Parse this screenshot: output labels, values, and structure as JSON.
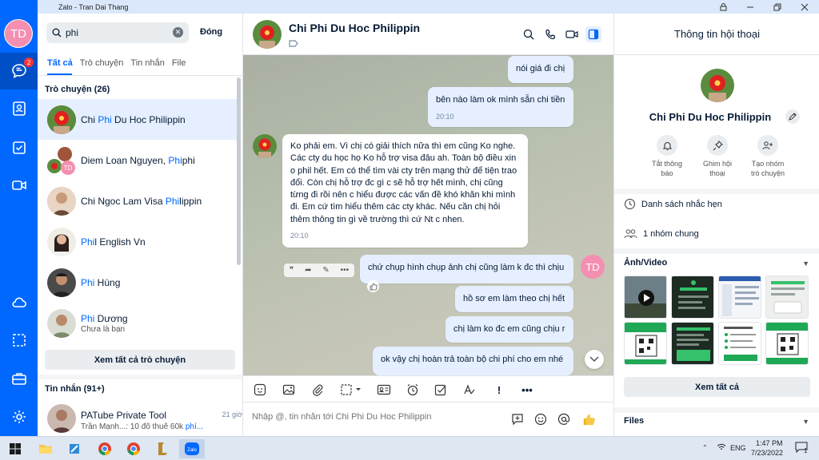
{
  "window": {
    "title": "Zalo - Tran Dai Thang"
  },
  "user": {
    "initials": "TD"
  },
  "nav": {
    "messages_badge": "2"
  },
  "search": {
    "value": "phi",
    "close_label": "Đóng"
  },
  "tabs": [
    "Tất cả",
    "Trò chuyện",
    "Tin nhắn",
    "File"
  ],
  "conversations_section": "Trò chuyện (26)",
  "conversations": [
    {
      "pre": "Chi ",
      "hl": "Phi",
      "post": " Du Hoc Philippin",
      "sub": ""
    },
    {
      "pre": "Diem Loan Nguyen, ",
      "hl": "Phi",
      "post": "phi",
      "sub": ""
    },
    {
      "pre": "Chi Ngoc Lam Visa ",
      "hl": "Phi",
      "post": "lippin",
      "sub": ""
    },
    {
      "pre": "",
      "hl": "Phi",
      "post": "l English Vn",
      "sub": ""
    },
    {
      "pre": "",
      "hl": "Phi",
      "post": " Hùng",
      "sub": ""
    },
    {
      "pre": "",
      "hl": "Phi",
      "post": " Dương",
      "sub": "Chưa là bạn"
    }
  ],
  "see_all_conversations": "Xem tất cả trò chuyện",
  "messages_section": "Tin nhắn (91+)",
  "message_results": [
    {
      "name": "PATube Private Tool",
      "time": "21 giờ",
      "sub_pre": "Trần Mạnh...: 10 đô thuê 60k ",
      "sub_hl": "phí..."
    }
  ],
  "chat": {
    "title": "Chi Phi Du Hoc Philippin",
    "messages": [
      {
        "from": "me",
        "text": "nói giá đi chị",
        "time": ""
      },
      {
        "from": "me",
        "text": "bên nào làm ok mình sẵn chi tiền",
        "time": "20:10"
      },
      {
        "from": "them",
        "text": "Ko phải em. Vì chị có giải thích nữa thì em cũng Ko nghe. Các cty du học họ Ko hỗ trợ visa đâu ah. Toàn bộ điều xin o phil hết. Em có thể tìm vài cty trên mạng thử để tiện trao đổi. Còn chị hỗ trợ đc gì c sẽ hỗ trợ hết mình, chị cũng từng đi rồi nên c hiểu được các vấn đề khó khăn khi mình đi. Em cứ tìm hiểu thêm các cty khác. Nếu cần chị hỏi thêm thông tin gì về trường thì cứ Nt c nhen.",
        "time": "20:10"
      },
      {
        "from": "me",
        "text": "chứ chụp hình chụp ảnh chị cũng làm k đc thì chịu",
        "time": ""
      },
      {
        "from": "me",
        "text": "hồ sơ em làm theo chị hết",
        "time": ""
      },
      {
        "from": "me",
        "text": "chị làm ko đc em cũng chịu r",
        "time": ""
      },
      {
        "from": "me",
        "text": "ok vậy chị hoàn trả toàn bộ chi phí cho em nhé",
        "time": ""
      }
    ],
    "composer_placeholder": "Nhập @, tin nhắn tới Chi Phi Du Hoc Philippin"
  },
  "info": {
    "header": "Thông tin hội thoại",
    "name": "Chi Phi Du Hoc Philippin",
    "actions": [
      {
        "label1": "Tắt thông",
        "label2": "báo"
      },
      {
        "label1": "Ghim hội",
        "label2": "thoại"
      },
      {
        "label1": "Tạo nhóm",
        "label2": "trò chuyện"
      }
    ],
    "reminders": "Danh sách nhắc hẹn",
    "groups": "1 nhóm chung",
    "media_title": "Ảnh/Video",
    "see_all": "Xem tất cả",
    "files_title": "Files"
  },
  "taskbar": {
    "lang": "ENG",
    "time": "1:47 PM",
    "date": "7/23/2022",
    "notif": "1"
  },
  "colors": {
    "accent": "#0068ff",
    "my_bubble": "#e5efff",
    "avatar_pink": "#f48fb1"
  }
}
